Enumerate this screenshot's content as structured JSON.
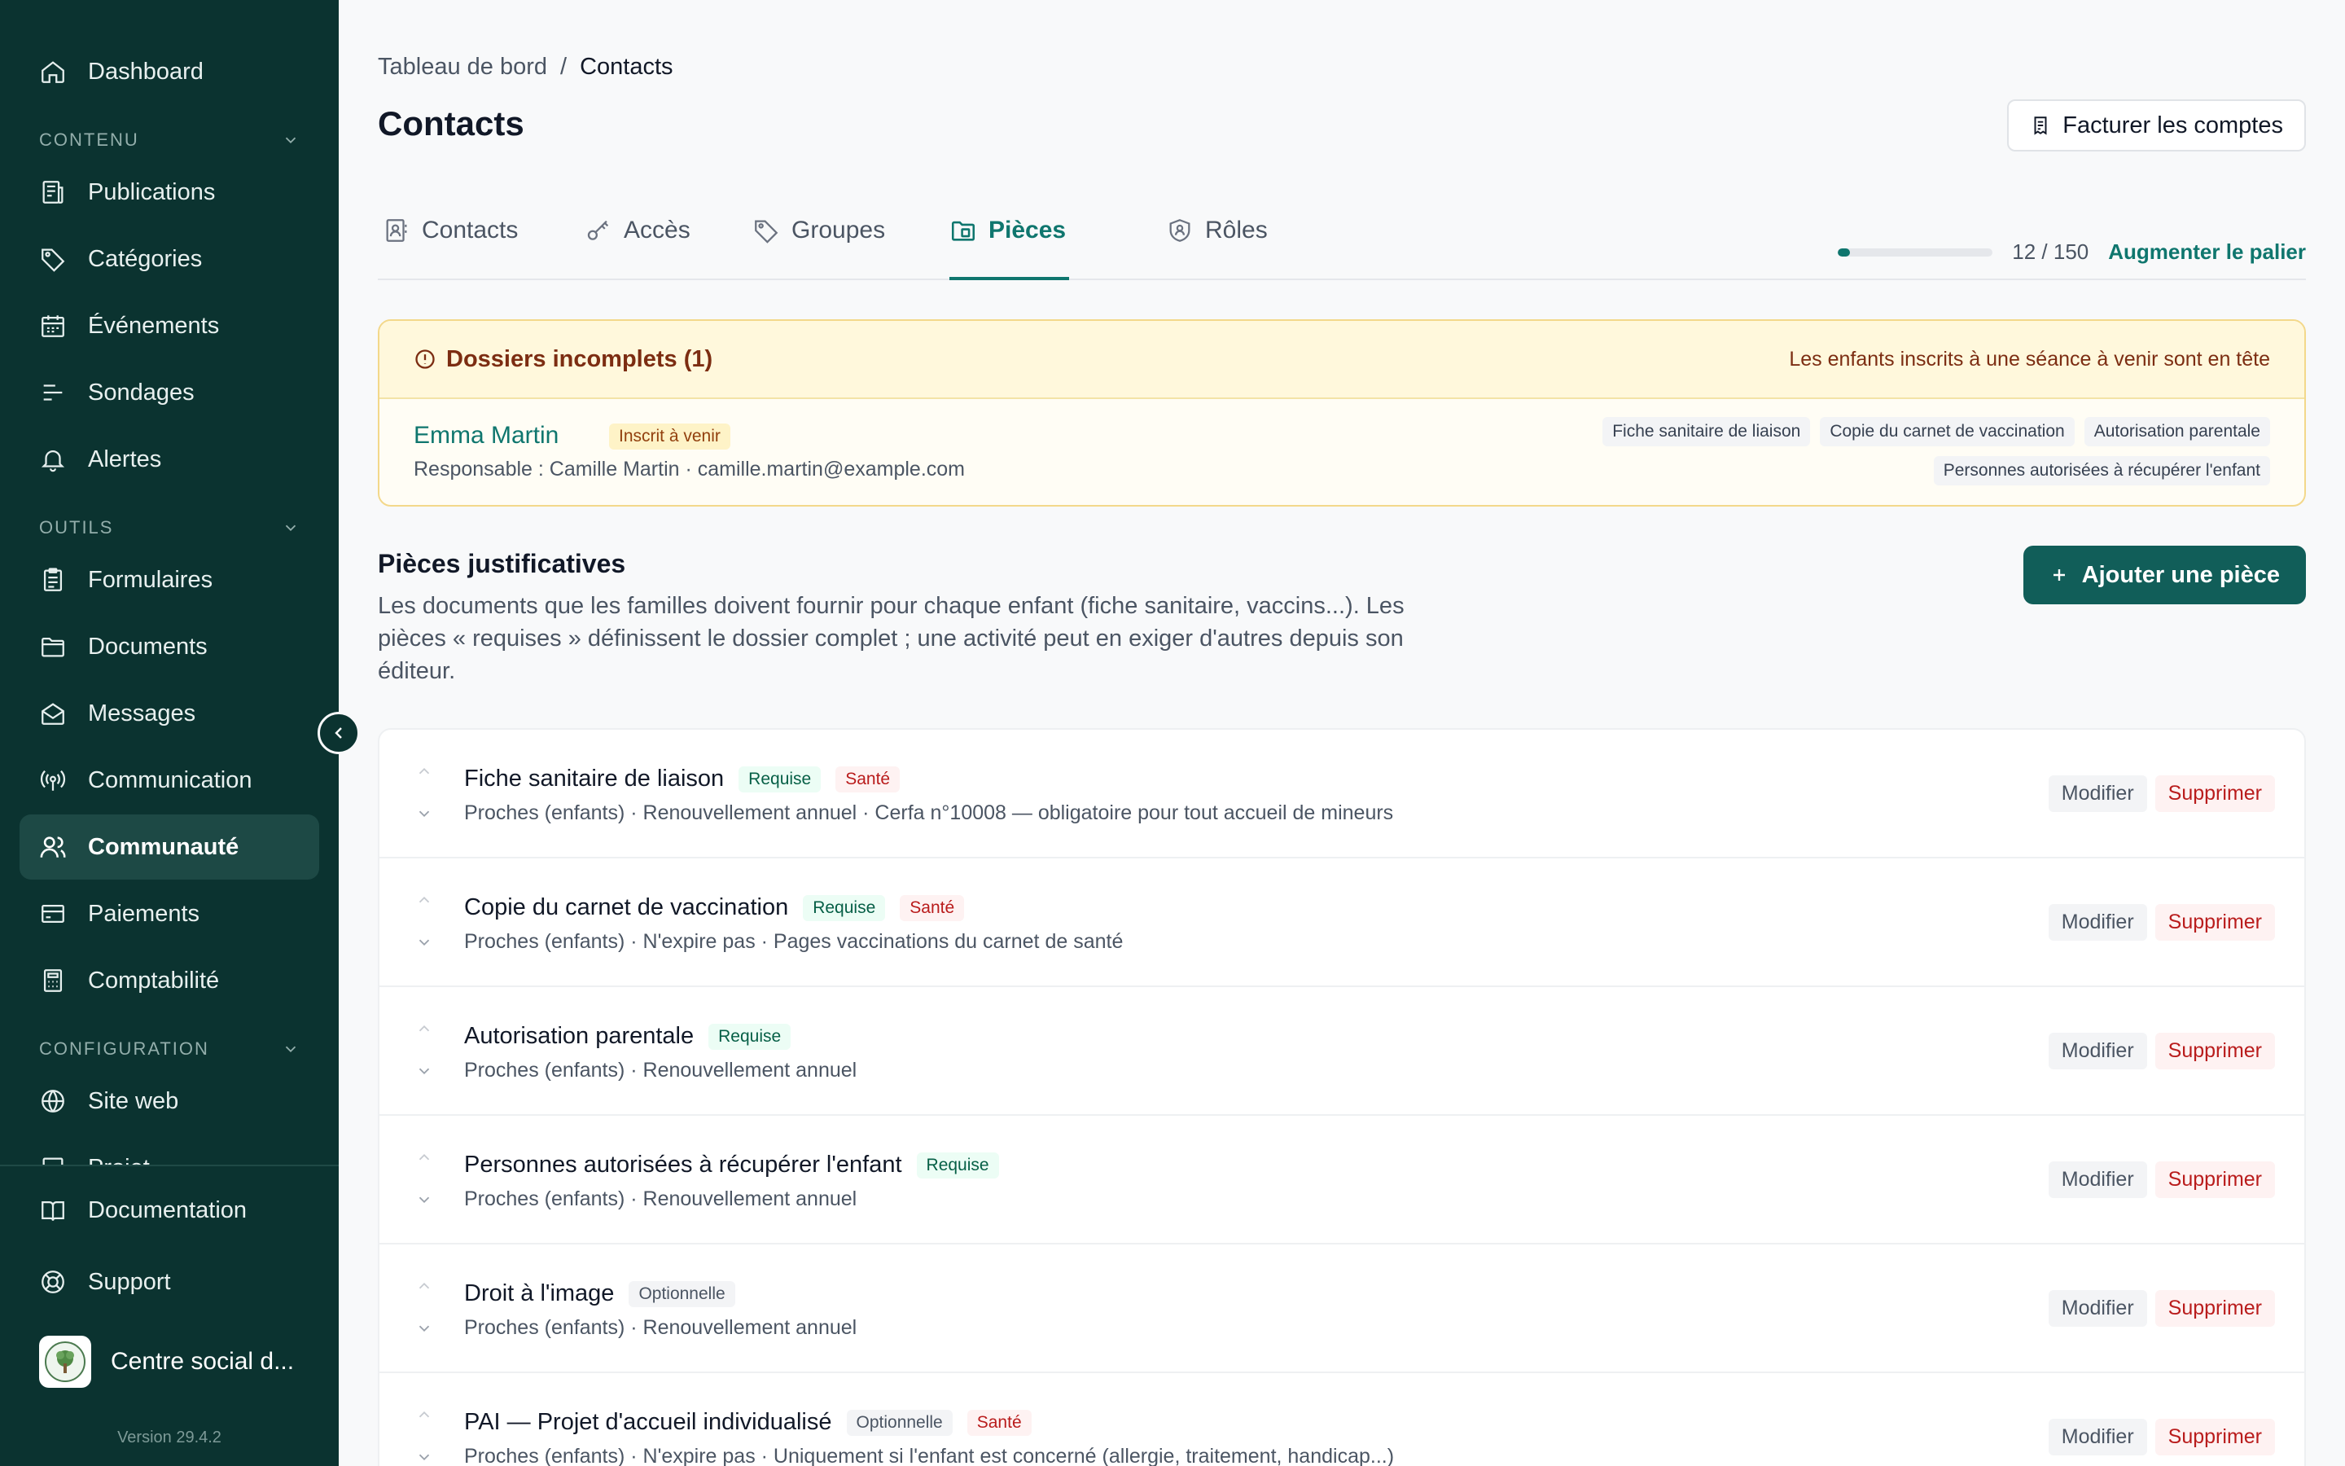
{
  "sidebar": {
    "dashboard": "Dashboard",
    "sections": {
      "contenu": "CONTENU",
      "outils": "OUTILS",
      "configuration": "CONFIGURATION"
    },
    "items": {
      "publications": "Publications",
      "categories": "Catégories",
      "evenements": "Événements",
      "sondages": "Sondages",
      "alertes": "Alertes",
      "formulaires": "Formulaires",
      "documents": "Documents",
      "messages": "Messages",
      "communication": "Communication",
      "communaute": "Communauté",
      "paiements": "Paiements",
      "comptabilite": "Comptabilité",
      "site_web": "Site web",
      "projet": "Projet"
    },
    "bottom": {
      "documentation": "Documentation",
      "support": "Support",
      "org_name": "Centre social d...",
      "version": "Version 29.4.2"
    }
  },
  "header": {
    "breadcrumb_root": "Tableau de bord",
    "breadcrumb_sep": "/",
    "breadcrumb_current": "Contacts",
    "title": "Contacts",
    "bill_button": "Facturer les comptes"
  },
  "tabs": {
    "contacts": "Contacts",
    "acces": "Accès",
    "groupes": "Groupes",
    "pieces": "Pièces",
    "roles": "Rôles"
  },
  "quota": {
    "used": 12,
    "total": 150,
    "label": "12 / 150",
    "upgrade": "Augmenter le palier"
  },
  "alert": {
    "title": "Dossiers incomplets (1)",
    "note": "Les enfants inscrits à une séance à venir sont en tête",
    "child_name": "Emma Martin",
    "child_badge": "Inscrit à venir",
    "responsible": "Responsable : Camille Martin · camille.martin@example.com",
    "missing": [
      "Fiche sanitaire de liaison",
      "Copie du carnet de vaccination",
      "Autorisation parentale",
      "Personnes autorisées à récupérer l'enfant"
    ]
  },
  "section": {
    "title": "Pièces justificatives",
    "description": "Les documents que les familles doivent fournir pour chaque enfant (fiche sanitaire, vaccins...). Les pièces « requises » définissent le dossier complet ; une activité peut en exiger d'autres depuis son éditeur.",
    "add_button": "Ajouter une pièce"
  },
  "actions": {
    "edit": "Modifier",
    "delete": "Supprimer"
  },
  "pieces": [
    {
      "title": "Fiche sanitaire de liaison",
      "badges": [
        "Requise",
        "Santé"
      ],
      "meta": "Proches (enfants) · Renouvellement annuel · Cerfa n°10008 — obligatoire pour tout accueil de mineurs"
    },
    {
      "title": "Copie du carnet de vaccination",
      "badges": [
        "Requise",
        "Santé"
      ],
      "meta": "Proches (enfants) · N'expire pas · Pages vaccinations du carnet de santé"
    },
    {
      "title": "Autorisation parentale",
      "badges": [
        "Requise"
      ],
      "meta": "Proches (enfants) · Renouvellement annuel"
    },
    {
      "title": "Personnes autorisées à récupérer l'enfant",
      "badges": [
        "Requise"
      ],
      "meta": "Proches (enfants) · Renouvellement annuel"
    },
    {
      "title": "Droit à l'image",
      "badges": [
        "Optionnelle"
      ],
      "meta": "Proches (enfants) · Renouvellement annuel"
    },
    {
      "title": "PAI — Projet d'accueil individualisé",
      "badges": [
        "Optionnelle",
        "Santé"
      ],
      "meta": "Proches (enfants) · N'expire pas · Uniquement si l'enfant est concerné (allergie, traitement, handicap...)"
    }
  ],
  "colors": {
    "sidebar_bg": "#0b3330",
    "accent": "#0f766e",
    "danger": "#b91c1c",
    "warning_bg": "#fff8dc"
  }
}
